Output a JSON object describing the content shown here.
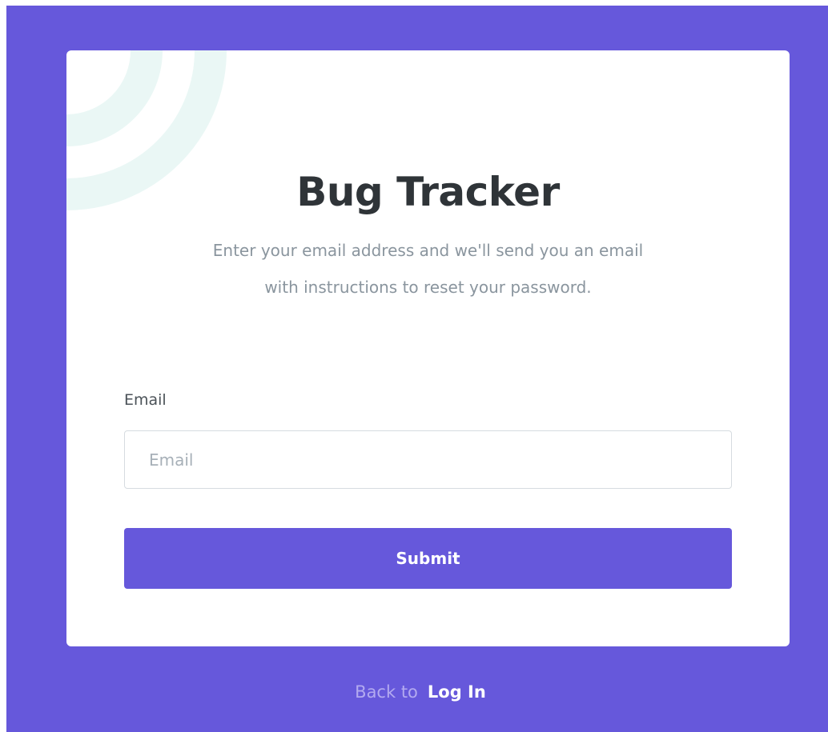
{
  "app": {
    "title": "Bug Tracker"
  },
  "reset_form": {
    "description": "Enter your email address and we'll send you an email with instructions to reset your password.",
    "email_label": "Email",
    "email_placeholder": "Email",
    "email_value": "",
    "submit_label": "Submit"
  },
  "footer": {
    "back_text": "Back to",
    "login_link": "Log In"
  },
  "colors": {
    "background": "#6658db",
    "accent": "#6658db",
    "card": "#ffffff",
    "decoration": "#eaf7f5"
  }
}
